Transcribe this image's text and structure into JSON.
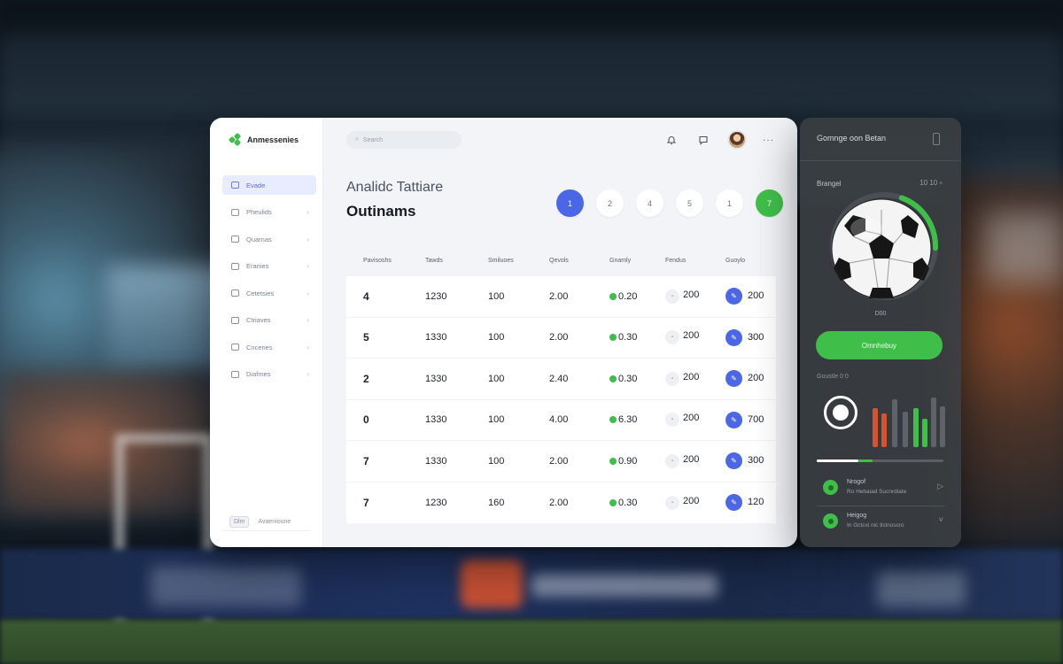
{
  "app": {
    "brand": "Anmessenies"
  },
  "search": {
    "placeholder": "Search"
  },
  "sidebar": {
    "items": [
      {
        "label": "Evade",
        "active": true
      },
      {
        "label": "Pheulids"
      },
      {
        "label": "Quarnas"
      },
      {
        "label": "Eranies"
      },
      {
        "label": "Cetetsies"
      },
      {
        "label": "Ctriaves"
      },
      {
        "label": "Cncenes"
      },
      {
        "label": "Diafmes"
      }
    ],
    "footer_chip": "Dlm",
    "footer_text": "Avaenioune"
  },
  "header": {
    "subtitle": "Analidc Tattiare",
    "title": "Outinams"
  },
  "pager": [
    "1",
    "2",
    "4",
    "5",
    "1",
    "7"
  ],
  "table": {
    "columns": [
      "Pavisoshs",
      "Tawds",
      "Smiluoes",
      "Qevols",
      "Gnamly",
      "Fendus",
      "Guoylo"
    ],
    "rows": [
      [
        "4",
        "1230",
        "100",
        "2.00",
        "0.20",
        "200",
        "200"
      ],
      [
        "5",
        "1330",
        "100",
        "2.00",
        "0.30",
        "200",
        "300"
      ],
      [
        "2",
        "1330",
        "100",
        "2.40",
        "0.30",
        "200",
        "200"
      ],
      [
        "0",
        "1330",
        "100",
        "4.00",
        "6.30",
        "200",
        "700"
      ],
      [
        "7",
        "1330",
        "100",
        "2.00",
        "0.90",
        "200",
        "300"
      ],
      [
        "7",
        "1230",
        "160",
        "2.00",
        "0.30",
        "200",
        "120"
      ]
    ]
  },
  "panel": {
    "title": "Gomnge oon Betan",
    "subtitle": "Brangel",
    "subtitle_right": "10 10",
    "ball_caption": "D00",
    "cta": "Omnhebuy",
    "section": "Goustle 0 0",
    "progress": 0.44,
    "list": [
      {
        "title": "Nrogof",
        "sub": "Ro Hebaiad Sucnrdiate"
      },
      {
        "title": "Heigog",
        "sub": "In Gctcxi nic ticinoscro"
      }
    ]
  },
  "colors": {
    "accent_blue": "#4b67e6",
    "accent_green": "#3fbf4a",
    "accent_red": "#d3542f"
  }
}
